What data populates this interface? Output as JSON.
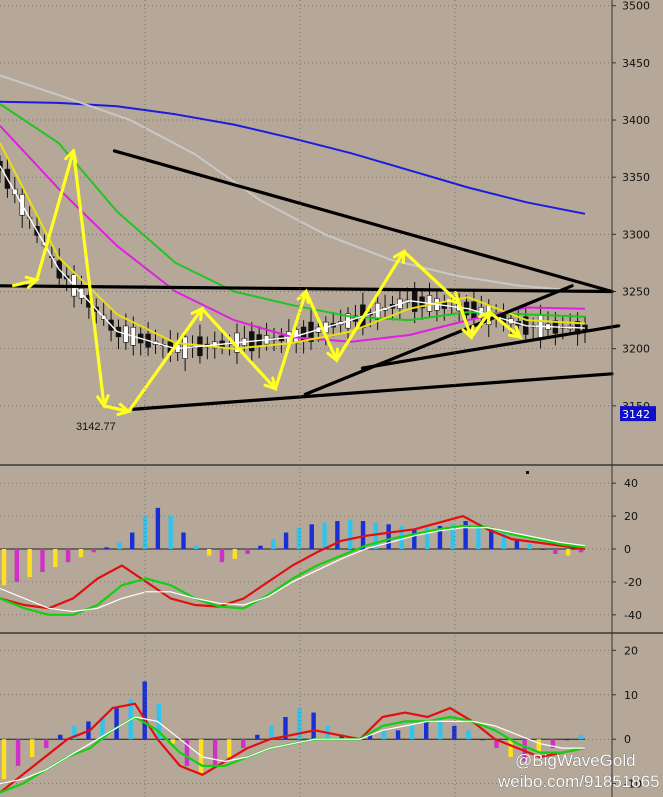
{
  "chart_data": [
    {
      "type": "candlestick",
      "panel": "price",
      "y_ticks": [
        3500,
        3450,
        3400,
        3350,
        3300,
        3250,
        3200,
        3150
      ],
      "ylim": [
        3100,
        3505
      ],
      "current_price_label": "3142",
      "annotations": [
        {
          "text": "3142.77",
          "value": 3142.77
        }
      ],
      "grid": true,
      "series": [
        {
          "name": "",
          "color": "#1c1cdc",
          "style": "line",
          "values": [
            3416,
            3415,
            3412,
            3405,
            3396,
            3384,
            3371,
            3356,
            3341,
            3328,
            3318
          ]
        },
        {
          "name": "",
          "color": "#c8c8c8",
          "style": "line",
          "values": [
            3439,
            3420,
            3400,
            3370,
            3330,
            3300,
            3278,
            3264,
            3255,
            3250
          ]
        },
        {
          "name": "",
          "color": "#22c422",
          "style": "line",
          "values": [
            3414,
            3380,
            3320,
            3275,
            3250,
            3238,
            3228,
            3225,
            3232,
            3230,
            3228
          ]
        },
        {
          "name": "",
          "color": "#e020e0",
          "style": "line",
          "values": [
            3395,
            3340,
            3290,
            3250,
            3225,
            3210,
            3206,
            3212,
            3225,
            3236,
            3235
          ]
        },
        {
          "name": "",
          "color": "#e8e010",
          "style": "line",
          "values": [
            3380,
            3280,
            3230,
            3205,
            3200,
            3205,
            3215,
            3235,
            3245,
            3225,
            3222
          ]
        },
        {
          "name": "",
          "color": "#ffffff",
          "style": "line",
          "values": [
            3360,
            3270,
            3215,
            3200,
            3205,
            3210,
            3225,
            3242,
            3235,
            3220,
            3218
          ]
        }
      ],
      "trendlines": [
        {
          "color": "#000000",
          "from": [
            0.18,
            3373
          ],
          "to": [
            0.92,
            3250
          ]
        },
        {
          "color": "#000000",
          "from": [
            0.0,
            3255
          ],
          "to": [
            0.92,
            3250
          ]
        },
        {
          "color": "#000000",
          "from": [
            0.21,
            3147
          ],
          "to": [
            0.92,
            3178
          ]
        },
        {
          "color": "#000000",
          "from": [
            0.48,
            3160
          ],
          "to": [
            0.86,
            3255
          ]
        },
        {
          "color": "#000000",
          "from": [
            0.57,
            3183
          ],
          "to": [
            0.93,
            3220
          ]
        }
      ],
      "zigzag": {
        "color": "#ffff20",
        "points": [
          [
            0.02,
            3255
          ],
          [
            0.06,
            3260
          ],
          [
            0.12,
            3373
          ],
          [
            0.17,
            3150
          ],
          [
            0.21,
            3145
          ],
          [
            0.33,
            3235
          ],
          [
            0.45,
            3165
          ],
          [
            0.5,
            3250
          ],
          [
            0.55,
            3190
          ],
          [
            0.66,
            3285
          ],
          [
            0.75,
            3240
          ],
          [
            0.77,
            3210
          ],
          [
            0.8,
            3232
          ],
          [
            0.85,
            3210
          ]
        ]
      }
    },
    {
      "type": "bar",
      "panel": "macd_1",
      "y_ticks": [
        40,
        20,
        0,
        -20,
        -40
      ],
      "ylim": [
        -48,
        48
      ],
      "histogram": [
        -22,
        -20,
        -17,
        -14,
        -11,
        -8,
        -5,
        -2,
        1,
        4,
        10,
        20,
        25,
        20,
        10,
        2,
        -4,
        -8,
        -6,
        -3,
        2,
        6,
        10,
        13,
        15,
        16,
        17,
        18,
        17,
        16,
        15,
        14,
        12,
        13,
        14,
        15,
        17,
        16,
        13,
        10,
        6,
        3,
        0,
        -3,
        -4,
        -2
      ],
      "series": [
        {
          "name": "",
          "color": "#e01010",
          "values": [
            -30,
            -34,
            -36,
            -30,
            -18,
            -10,
            -20,
            -30,
            -34,
            -35,
            -30,
            -20,
            -10,
            -2,
            5,
            8,
            10,
            12,
            16,
            20,
            12,
            6,
            4,
            2,
            0
          ]
        },
        {
          "name": "",
          "color": "#10d010",
          "values": [
            -30,
            -36,
            -40,
            -40,
            -34,
            -22,
            -18,
            -22,
            -30,
            -35,
            -36,
            -28,
            -18,
            -10,
            -4,
            2,
            6,
            9,
            12,
            14,
            13,
            9,
            6,
            3,
            1
          ]
        },
        {
          "name": "",
          "color": "#ffffff",
          "values": [
            -24,
            -30,
            -36,
            -38,
            -36,
            -30,
            -26,
            -26,
            -30,
            -33,
            -34,
            -29,
            -20,
            -13,
            -6,
            0,
            4,
            8,
            11,
            13,
            13,
            10,
            7,
            4,
            2
          ]
        }
      ]
    },
    {
      "type": "bar",
      "panel": "macd_2",
      "y_ticks": [
        20,
        10,
        0,
        -10
      ],
      "ylim": [
        -13,
        23
      ],
      "histogram": [
        -9,
        -6,
        -4,
        -2,
        1,
        3,
        4,
        5,
        7,
        9,
        13,
        8,
        -1,
        -6,
        -8,
        -6,
        -4,
        -2,
        1,
        3,
        5,
        7,
        6,
        3,
        1,
        0,
        1,
        2,
        2,
        3,
        4,
        4,
        3,
        2,
        0,
        -2,
        -4,
        -5,
        -3,
        -2,
        0,
        1
      ],
      "series": [
        {
          "name": "",
          "color": "#e01010",
          "values": [
            -12,
            -8,
            -4,
            0,
            2,
            7,
            8,
            0,
            -6,
            -8,
            -5,
            -2,
            0,
            1,
            2,
            1,
            0,
            5,
            6,
            5,
            7,
            4,
            0,
            -2,
            -4,
            -3,
            -2
          ]
        },
        {
          "name": "",
          "color": "#10d010",
          "values": [
            -12,
            -10,
            -7,
            -4,
            -2,
            2,
            5,
            2,
            -3,
            -6,
            -6,
            -4,
            -2,
            -1,
            0,
            0,
            0,
            3,
            4,
            4,
            5,
            4,
            2,
            -1,
            -3,
            -3,
            -2
          ]
        },
        {
          "name": "",
          "color": "#ffffff",
          "values": [
            -10,
            -9,
            -7,
            -4,
            -1,
            2,
            5,
            4,
            0,
            -4,
            -5,
            -4,
            -2,
            -1,
            0,
            0,
            0,
            2,
            3,
            4,
            4,
            4,
            3,
            1,
            -1,
            -2,
            -2
          ]
        }
      ]
    }
  ],
  "watermark": {
    "handle": "@BigWaveGold",
    "url": "weibo.com/91851865"
  },
  "colors": {
    "background": "#b5a898",
    "hist_pos": [
      "#1a2ed6",
      "#30c4ec"
    ],
    "hist_neg": [
      "#ffe020",
      "#d030c8"
    ]
  }
}
